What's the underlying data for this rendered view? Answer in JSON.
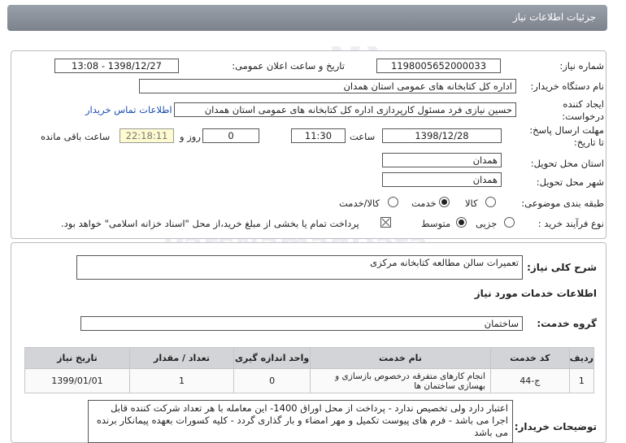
{
  "header": {
    "title": "جزئیات اطلاعات نیاز"
  },
  "fields": {
    "need_number_label": "شماره نیاز:",
    "need_number": "1198005652000033",
    "announce_label": "تاریخ و ساعت اعلان عمومی:",
    "announce_value": "1398/12/27 - 13:08",
    "buyer_label": "نام دستگاه خریدار:",
    "buyer_value": "اداره کل کتابخانه های عمومی استان همدان",
    "creator_label": "ایجاد کننده درخواست:",
    "creator_value": "حسین نیازی فرد مسئول کارپردازی اداره کل کتابخانه های عمومی استان همدان",
    "contact_link": "اطلاعات تماس خریدار",
    "deadline_label": "مهلت ارسال پاسخ: تا تاریخ:",
    "deadline_date": "1398/12/28",
    "time_label": "ساعت",
    "deadline_time": "11:30",
    "days_value": "0",
    "days_label": "روز و",
    "remaining_time": "22:18:11",
    "remaining_label": "ساعت باقی مانده",
    "province_label": "استان محل تحویل:",
    "province_value": "همدان",
    "city_label": "شهر محل تحویل:",
    "city_value": "همدان",
    "category_label": "طبقه بندی موضوعی:",
    "category_options": [
      "کالا",
      "خدمت",
      "کالا/خدمت"
    ],
    "category_selected": "خدمت",
    "process_label": "نوع فرآیند خرید :",
    "process_options": [
      "جزیی",
      "متوسط"
    ],
    "process_selected": "متوسط",
    "payment_note": "پرداخت تمام یا بخشی از مبلغ خرید،از محل \"اسناد خزانه اسلامی\" خواهد بود."
  },
  "summary": {
    "label": "شرح کلی نیاز:",
    "value": "تعمیرات سالن مطالعه کتابخانه مرکزی"
  },
  "services": {
    "section_title": "اطلاعات خدمات مورد نیاز",
    "group_label": "گروه خدمت:",
    "group_value": "ساختمان",
    "columns": [
      "ردیف",
      "کد خدمت",
      "نام خدمت",
      "واحد اندازه گیری",
      "تعداد / مقدار",
      "تاریخ نیاز"
    ],
    "rows": [
      [
        "1",
        "ج-44",
        "انجام کارهای متفرقه درخصوص بازسازی و بهسازی ساختمان ها",
        "0",
        "1",
        "1399/01/01"
      ]
    ]
  },
  "buyer_notes": {
    "label": "توضیحات خریدار:",
    "value": "اعتبار دارد ولی تخصیص ندارد - پرداخت از محل اوراق 1400- این معامله با هر تعداد شرکت کننده قابل اجرا می باشد - فرم های پیوست تکمیل و مهر امضاء و بار گذاری گردد - کلیه کسورات بعهده پیمانکار برنده می باشد"
  }
}
